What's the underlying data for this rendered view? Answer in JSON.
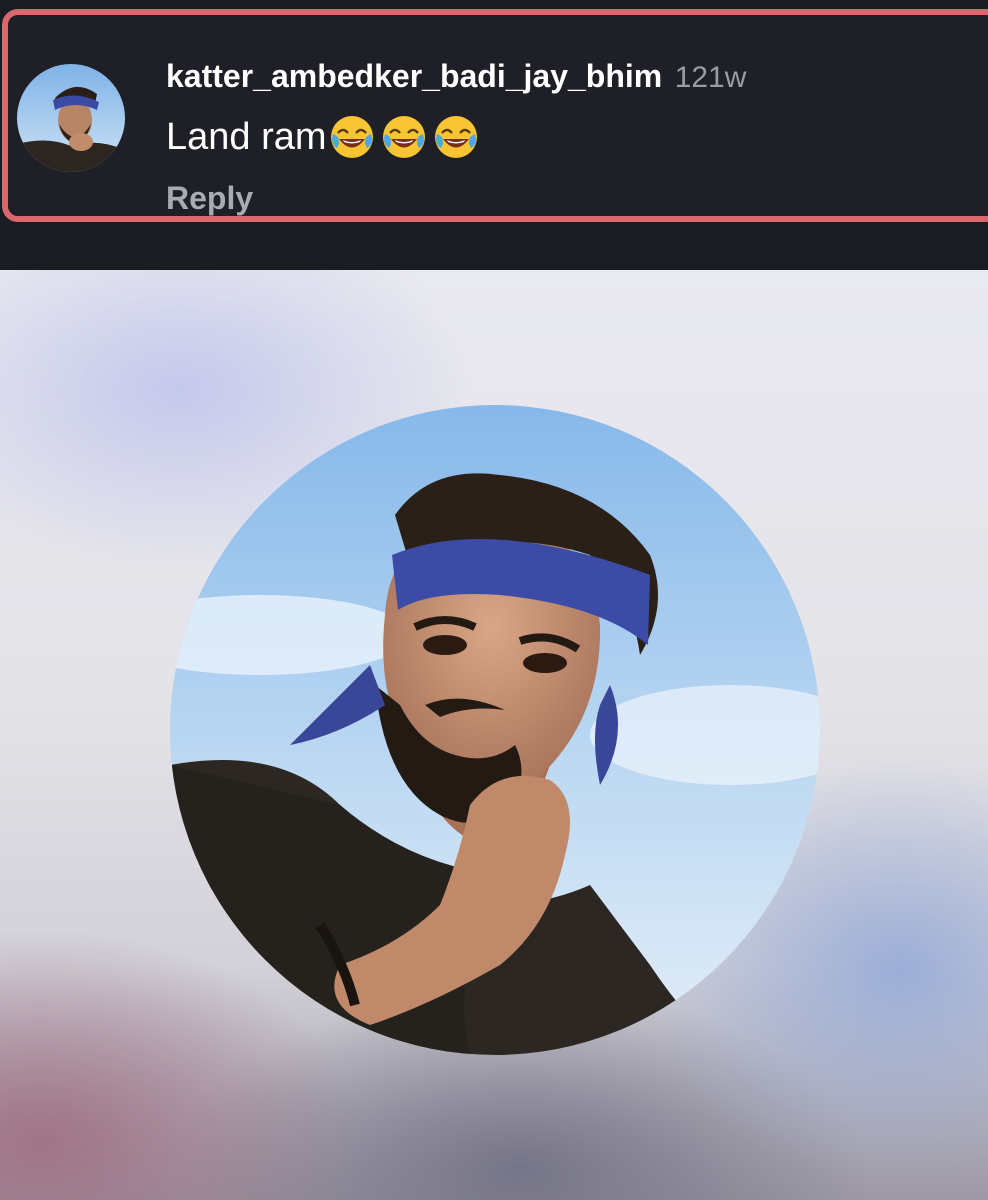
{
  "comment": {
    "username": "katter_ambedker_badi_jay_bhim",
    "timestamp": "121w",
    "text": "Land ram",
    "emojis": [
      "face-with-tears-of-joy",
      "face-with-tears-of-joy",
      "face-with-tears-of-joy"
    ],
    "reply_label": "Reply"
  },
  "profile_photo": {
    "subject": "profile-photo"
  },
  "colors": {
    "highlight_border": "#d9676c",
    "card_background": "#1e1f27",
    "username": "#ffffff",
    "timestamp": "#9a9ca5",
    "reply": "#a9abb2"
  }
}
